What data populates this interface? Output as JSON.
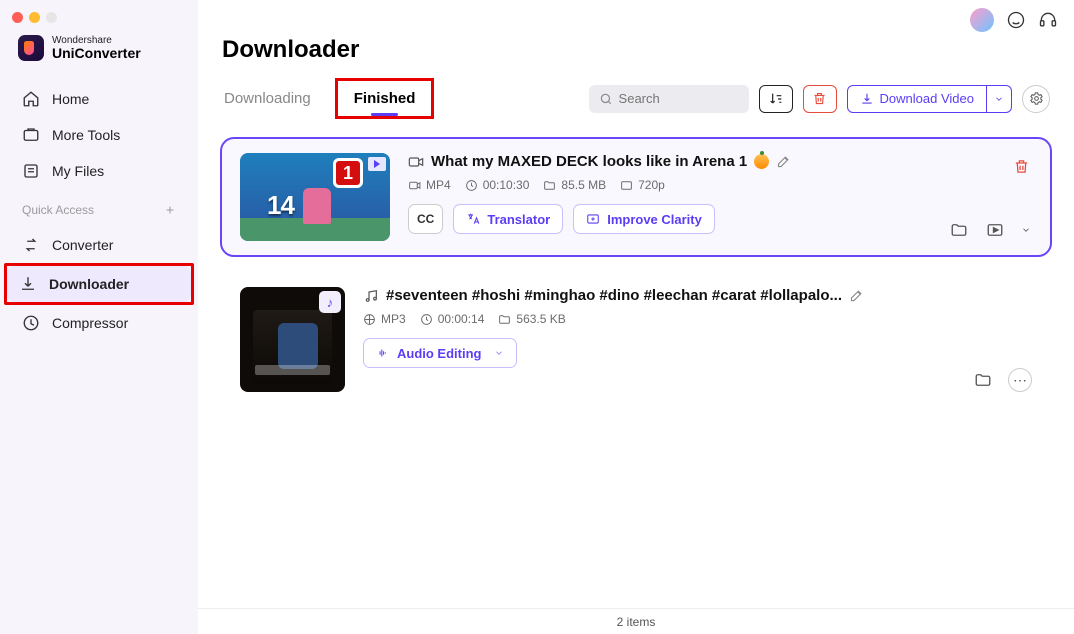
{
  "brand": {
    "line1": "Wondershare",
    "line2": "UniConverter"
  },
  "sidebar": {
    "items": [
      {
        "label": "Home",
        "icon": "home-icon"
      },
      {
        "label": "More Tools",
        "icon": "more-tools-icon"
      },
      {
        "label": "My Files",
        "icon": "my-files-icon"
      }
    ],
    "section": {
      "label": "Quick Access"
    },
    "quick": [
      {
        "label": "Converter",
        "icon": "converter-icon"
      },
      {
        "label": "Downloader",
        "icon": "downloader-icon",
        "active": true
      },
      {
        "label": "Compressor",
        "icon": "compressor-icon"
      }
    ]
  },
  "page": {
    "title": "Downloader"
  },
  "tabs": {
    "downloading": "Downloading",
    "finished": "Finished"
  },
  "search": {
    "placeholder": "Search"
  },
  "toolbar": {
    "download_label": "Download Video"
  },
  "items": [
    {
      "kind": "video",
      "title": "What my MAXED DECK looks like in Arena 1 ",
      "format": "MP4",
      "duration": "00:10:30",
      "size": "85.5 MB",
      "extra": "720p",
      "cc_label": "CC",
      "btn1": "Translator",
      "btn2": "Improve Clarity"
    },
    {
      "kind": "audio",
      "title": "#seventeen #hoshi #minghao #dino #leechan #carat #lollapalo...",
      "format": "MP3",
      "duration": "00:00:14",
      "size": "563.5 KB",
      "btn1": "Audio Editing"
    }
  ],
  "footer": {
    "count_label": "2 items"
  }
}
